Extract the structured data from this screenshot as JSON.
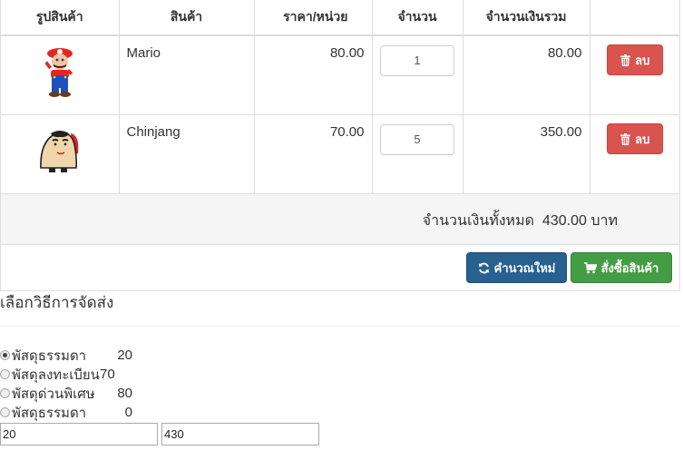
{
  "table": {
    "headers": [
      "รูปสินค้า",
      "สินค้า",
      "ราคา/หน่วย",
      "จำนวน",
      "จำนวนเงินรวม",
      ""
    ],
    "rows": [
      {
        "image": "mario-image",
        "name": "Mario",
        "price": "80.00",
        "qty": "1",
        "subtotal": "80.00",
        "delete_label": "ลบ"
      },
      {
        "image": "chinjang-image",
        "name": "Chinjang",
        "price": "70.00",
        "qty": "5",
        "subtotal": "350.00",
        "delete_label": "ลบ"
      }
    ]
  },
  "total": {
    "label": "จำนวนเงินทั้งหมด",
    "amount": "430.00",
    "unit": "บาท"
  },
  "actions": {
    "recalc_label": "คำนวณใหม่",
    "order_label": "สั่งซื้อสินค้า"
  },
  "shipping": {
    "title": "เลือกวิธีการจัดส่ง",
    "options": [
      {
        "label": "พัสดุธรรมดา",
        "price": "20",
        "checked": true
      },
      {
        "label": "พัสดุลงทะเบียน",
        "price": "70",
        "checked": false
      },
      {
        "label": "พัสดุด่วนพิเศษ",
        "price": "80",
        "checked": false
      },
      {
        "label": "พัสดุธรรมดา",
        "price": "0",
        "checked": false
      }
    ],
    "field_shipping_value": "20",
    "field_total_value": "430"
  },
  "colors": {
    "danger": "#d9534f",
    "primary": "#286090",
    "success": "#449d44"
  }
}
